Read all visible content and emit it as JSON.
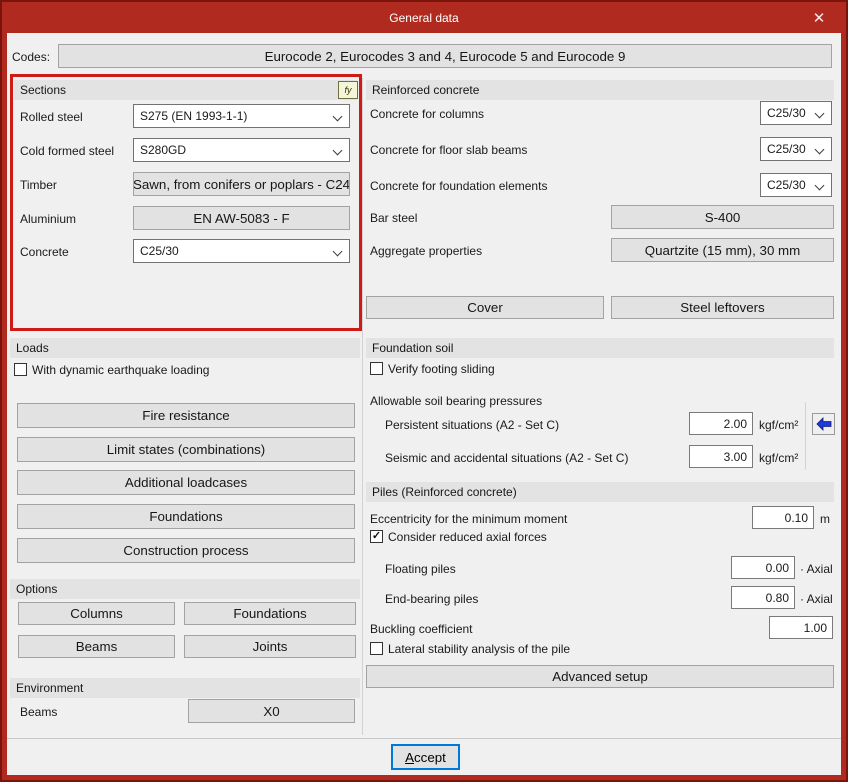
{
  "window": {
    "title": "General data",
    "close_glyph": "✕"
  },
  "colors": {
    "titlebar": "#b02a20",
    "frame_outer": "#7a130c",
    "content_bg": "#f0f0f0",
    "annotation_red": "#ce1b15",
    "accent_blue": "#0078d7",
    "arrow_blue": "#2139d6"
  },
  "codes": {
    "label": "Codes:",
    "value": "Eurocode 2, Eurocodes 3 and 4, Eurocode 5 and Eurocode 9"
  },
  "sections": {
    "title": "Sections",
    "icon_label": "fy",
    "rows": [
      {
        "label": "Rolled steel",
        "value": "S275 (EN 1993-1-1)"
      },
      {
        "label": "Cold formed steel",
        "value": "S280GD"
      },
      {
        "label": "Timber",
        "value": "Sawn, from conifers or poplars - C24"
      },
      {
        "label": "Aluminium",
        "value": "EN AW-5083 - F"
      },
      {
        "label": "Concrete",
        "value": "C25/30"
      }
    ]
  },
  "reinforced_concrete": {
    "title": "Reinforced concrete",
    "selects": [
      {
        "label": "Concrete for columns",
        "value": "C25/30"
      },
      {
        "label": "Concrete for floor slab beams",
        "value": "C25/30"
      },
      {
        "label": "Concrete for foundation elements",
        "value": "C25/30"
      }
    ],
    "value_rows": [
      {
        "label": "Bar steel",
        "value": "S-400"
      },
      {
        "label": "Aggregate properties",
        "value": "Quartzite (15 mm), 30 mm"
      }
    ],
    "cover_button": "Cover",
    "steel_leftovers_button": "Steel leftovers"
  },
  "loads": {
    "title": "Loads",
    "checkbox": {
      "label": "With dynamic earthquake loading",
      "glyph": ""
    },
    "buttons": [
      "Fire resistance",
      "Limit states (combinations)",
      "Additional loadcases",
      "Foundations",
      "Construction process"
    ]
  },
  "options": {
    "title": "Options",
    "buttons": [
      "Columns",
      "Foundations",
      "Beams",
      "Joints"
    ]
  },
  "environment": {
    "title": "Environment",
    "row": {
      "label": "Beams",
      "value": "X0"
    }
  },
  "foundation_soil": {
    "title": "Foundation soil",
    "checkbox": {
      "label": "Verify footing sliding",
      "glyph": ""
    },
    "group_label": "Allowable soil bearing pressures",
    "rows": [
      {
        "label": "Persistent situations (A2 - Set C)",
        "value": "2.00",
        "unit": "kgf/cm²"
      },
      {
        "label": "Seismic and accidental situations (A2 - Set C)",
        "value": "3.00",
        "unit": "kgf/cm²"
      }
    ]
  },
  "piles": {
    "title": "Piles (Reinforced concrete)",
    "eccentricity": {
      "label": "Eccentricity for the minimum moment",
      "value": "0.10",
      "unit": "m"
    },
    "reduced_checkbox": {
      "label": "Consider reduced axial forces",
      "glyph": "✓"
    },
    "axial_rows": [
      {
        "label": "Floating piles",
        "value": "0.00",
        "unit": "· Axial"
      },
      {
        "label": "End-bearing piles",
        "value": "0.80",
        "unit": "· Axial"
      }
    ],
    "buckling": {
      "label": "Buckling coefficient",
      "value": "1.00"
    },
    "lateral_checkbox": {
      "label": "Lateral stability analysis of the pile",
      "glyph": ""
    },
    "advanced_button": "Advanced setup"
  },
  "footer": {
    "accept": "Accept"
  }
}
